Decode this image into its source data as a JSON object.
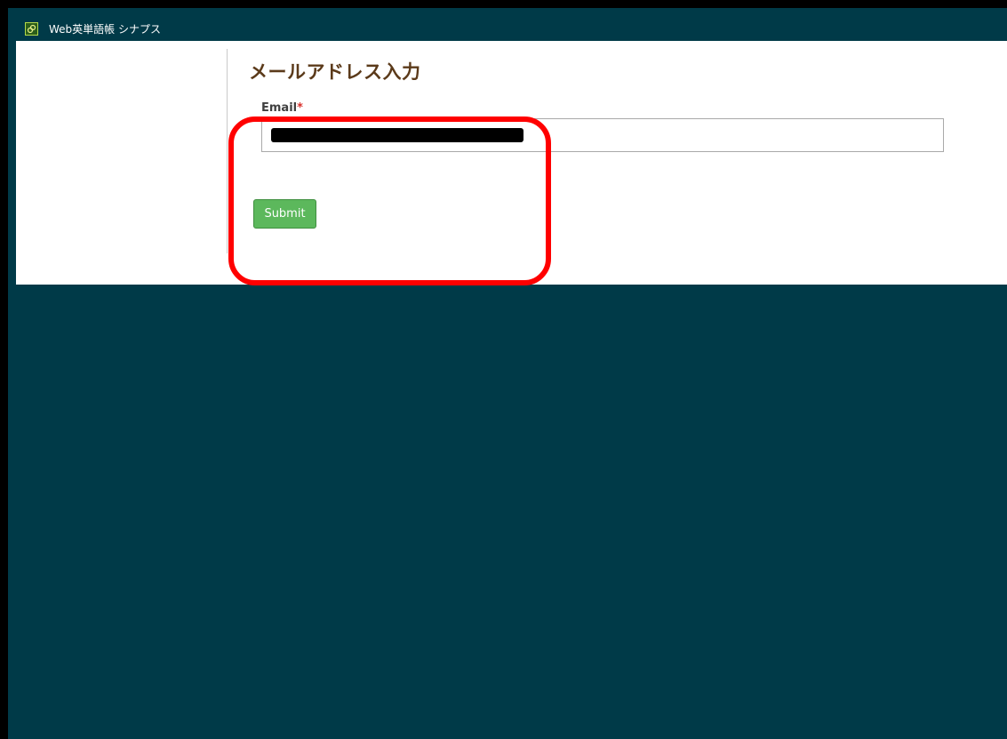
{
  "app": {
    "icon": "app-logo-icon",
    "title": "Web英単語帳 シナプス"
  },
  "page": {
    "title": "メールアドレス入力"
  },
  "form": {
    "email_label": "Email",
    "required_mark": "*",
    "email_value_redacted": true,
    "submit_label": "Submit"
  },
  "colors": {
    "header_bg": "#003a48",
    "title_color": "#5b3a1a",
    "submit_bg": "#5cb85c",
    "required_color": "#d9302b",
    "highlight": "#ff0000"
  }
}
